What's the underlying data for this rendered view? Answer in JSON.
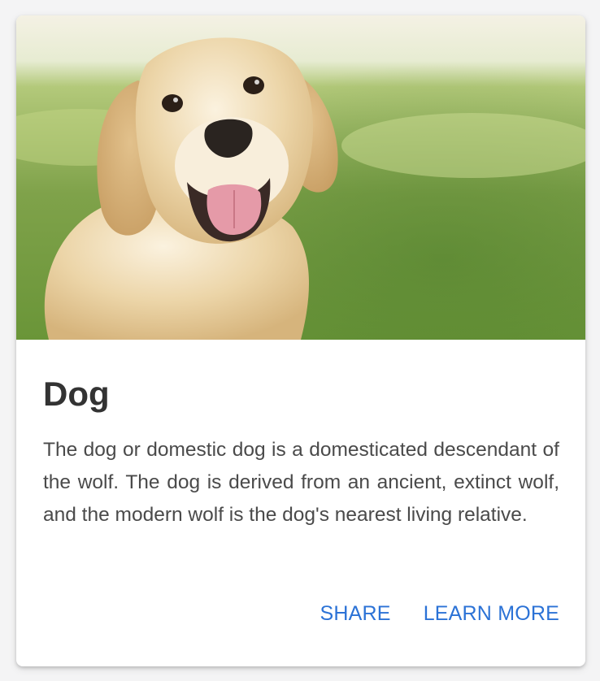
{
  "card": {
    "image": {
      "subject": "golden retriever dog on grass",
      "colors": {
        "grass": "#7fa24a",
        "grass_dark": "#5f8a35",
        "sky": "#f2efe2",
        "fur": "#e6cc9c",
        "fur_light": "#f6ead3",
        "nose": "#2a2420",
        "tongue": "#e59aa8"
      }
    },
    "title": "Dog",
    "description": "The dog or domestic dog is a domesticated descendant of the wolf. The dog is derived from an ancient, extinct wolf, and the modern wolf is the dog's nearest living relative.",
    "actions": {
      "share_label": "SHARE",
      "learn_more_label": "LEARN MORE"
    },
    "colors": {
      "accent": "#2b72d6",
      "title": "#333333",
      "text": "#4a4a4a",
      "background": "#ffffff"
    }
  }
}
